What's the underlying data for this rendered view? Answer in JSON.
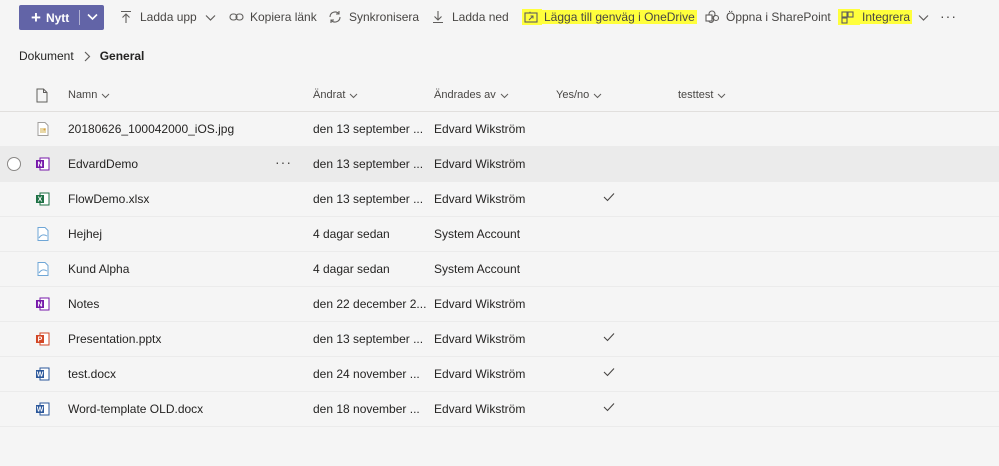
{
  "toolbar": {
    "new_label": "Nytt",
    "upload_label": "Ladda upp",
    "copy_link_label": "Kopiera länk",
    "sync_label": "Synkronisera",
    "download_label": "Ladda ned",
    "shortcut_label": "Lägga till genväg i OneDrive",
    "open_sharepoint_label": "Öppna i SharePoint",
    "integrate_label": "Integrera",
    "more_label": "···"
  },
  "breadcrumb": {
    "root": "Dokument",
    "current": "General"
  },
  "columns": {
    "name": "Namn",
    "modified": "Ändrat",
    "modified_by": "Ändrades av",
    "yesno": "Yes/no",
    "testtest": "testtest"
  },
  "rows": [
    {
      "name": "20180626_100042000_iOS.jpg",
      "icon": "image-file-icon",
      "modified": "den 13 september ...",
      "modified_by": "Edvard Wikström",
      "yesno": false
    },
    {
      "name": "EdvardDemo",
      "icon": "onenote-icon",
      "modified": "den 13 september ...",
      "modified_by": "Edvard Wikström",
      "yesno": false
    },
    {
      "name": "FlowDemo.xlsx",
      "icon": "excel-icon",
      "modified": "den 13 september ...",
      "modified_by": "Edvard Wikström",
      "yesno": true
    },
    {
      "name": "Hejhej",
      "icon": "link-file-icon",
      "modified": "4 dagar sedan",
      "modified_by": "System Account",
      "yesno": false
    },
    {
      "name": "Kund Alpha",
      "icon": "link-file-icon",
      "modified": "4 dagar sedan",
      "modified_by": "System Account",
      "yesno": false
    },
    {
      "name": "Notes",
      "icon": "onenote-icon",
      "modified": "den 22 december 2...",
      "modified_by": "Edvard Wikström",
      "yesno": false
    },
    {
      "name": "Presentation.pptx",
      "icon": "powerpoint-icon",
      "modified": "den 13 september ...",
      "modified_by": "Edvard Wikström",
      "yesno": true
    },
    {
      "name": "test.docx",
      "icon": "word-icon",
      "modified": "den 24 november ...",
      "modified_by": "Edvard Wikström",
      "yesno": true
    },
    {
      "name": "Word-template OLD.docx",
      "icon": "word-icon",
      "modified": "den 18 november ...",
      "modified_by": "Edvard Wikström",
      "yesno": true
    }
  ],
  "colors": {
    "accent": "#6264a7",
    "highlight": "#ffff3c",
    "background": "#f5f5f5"
  }
}
